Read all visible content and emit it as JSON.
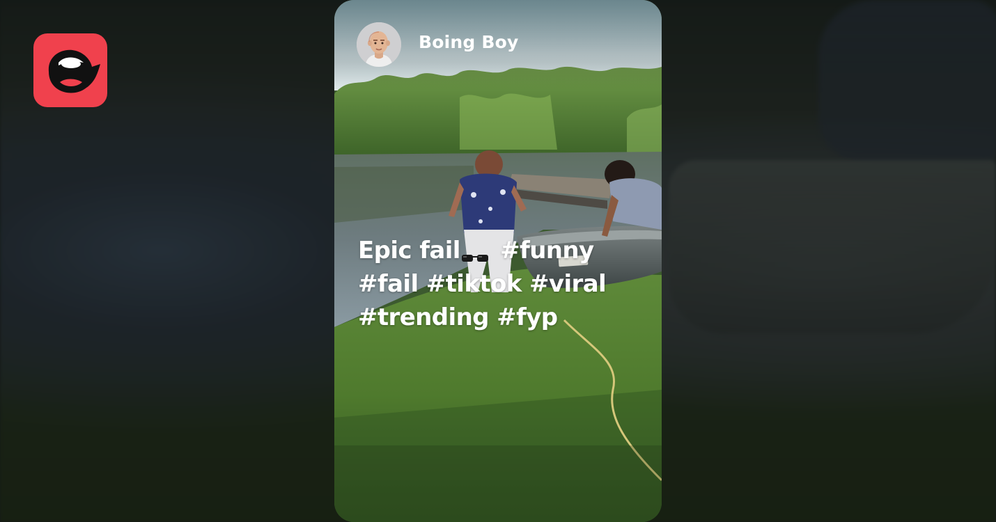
{
  "app": {
    "logo_icon": "app-logo-mouth-icon",
    "logo_color": "#f0414d"
  },
  "post": {
    "author": "Boing Boy",
    "avatar_icon": "bald-man-avatar",
    "caption_lines": {
      "line1_text": "Epic fail",
      "line1_emoji_icon": "sunglasses-icon",
      "line1_tag": "#funny",
      "line2": "#fail #tiktok #viral",
      "line3": "#trending #fyp"
    }
  },
  "colors": {
    "caption_text": "#ffffff",
    "username_text": "#ffffff"
  }
}
